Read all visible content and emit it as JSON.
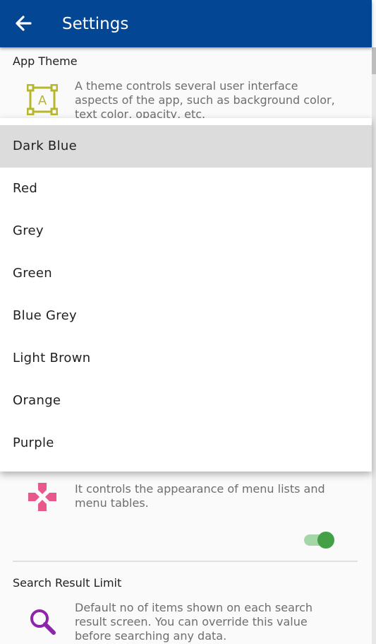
{
  "appbar": {
    "title": "Settings",
    "back_icon": "arrow-left-icon",
    "color": "#034694"
  },
  "theme_section": {
    "title": "App Theme",
    "icon": "text-frame-icon",
    "description": "A theme controls several user interface aspects of the app, such as background color, text color, opacity, etc."
  },
  "theme_menu": {
    "selected": "Dark Blue",
    "options": [
      "Dark Blue",
      "Red",
      "Grey",
      "Green",
      "Blue Grey",
      "Light Brown",
      "Orange",
      "Purple"
    ]
  },
  "menu_section": {
    "icon": "dpad-icon",
    "description": "It controls the appearance of menu lists and menu tables.",
    "toggle_on": true,
    "toggle_color": "#43a047"
  },
  "search_section": {
    "title": "Search Result Limit",
    "icon": "search-icon",
    "description": "Default no of items shown on each search result screen. You can override this value before searching any data."
  }
}
